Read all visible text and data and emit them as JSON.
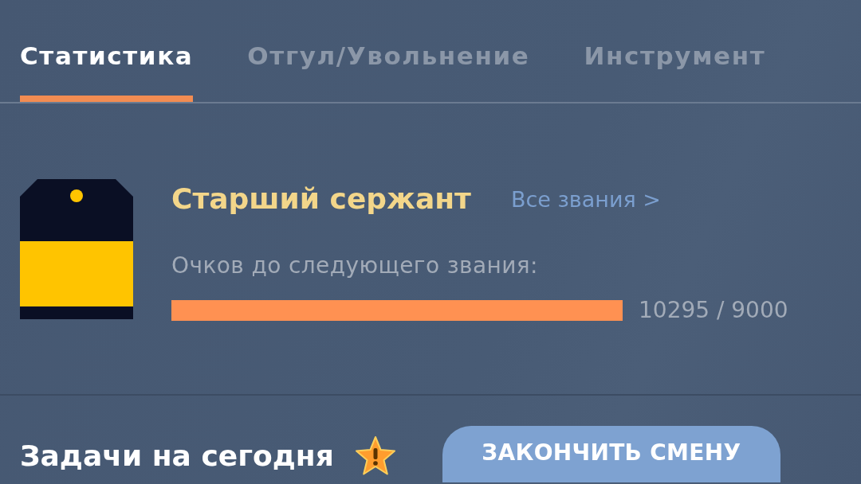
{
  "tabs": [
    {
      "label": "Статистика",
      "selected": true
    },
    {
      "label": "Отгул/Увольнение",
      "selected": false
    },
    {
      "label": "Инструмент",
      "selected": false
    }
  ],
  "rank": {
    "title": "Старший сержант",
    "all_ranks_link": "Все звания >",
    "progress_label": "Очков до следующего звания:",
    "level": 1,
    "reading": "10295 / 9000"
  },
  "tasks": {
    "title": "Задачи на сегодня",
    "end_shift_button": "ЗАКОНЧИТЬ СМЕНУ"
  }
}
